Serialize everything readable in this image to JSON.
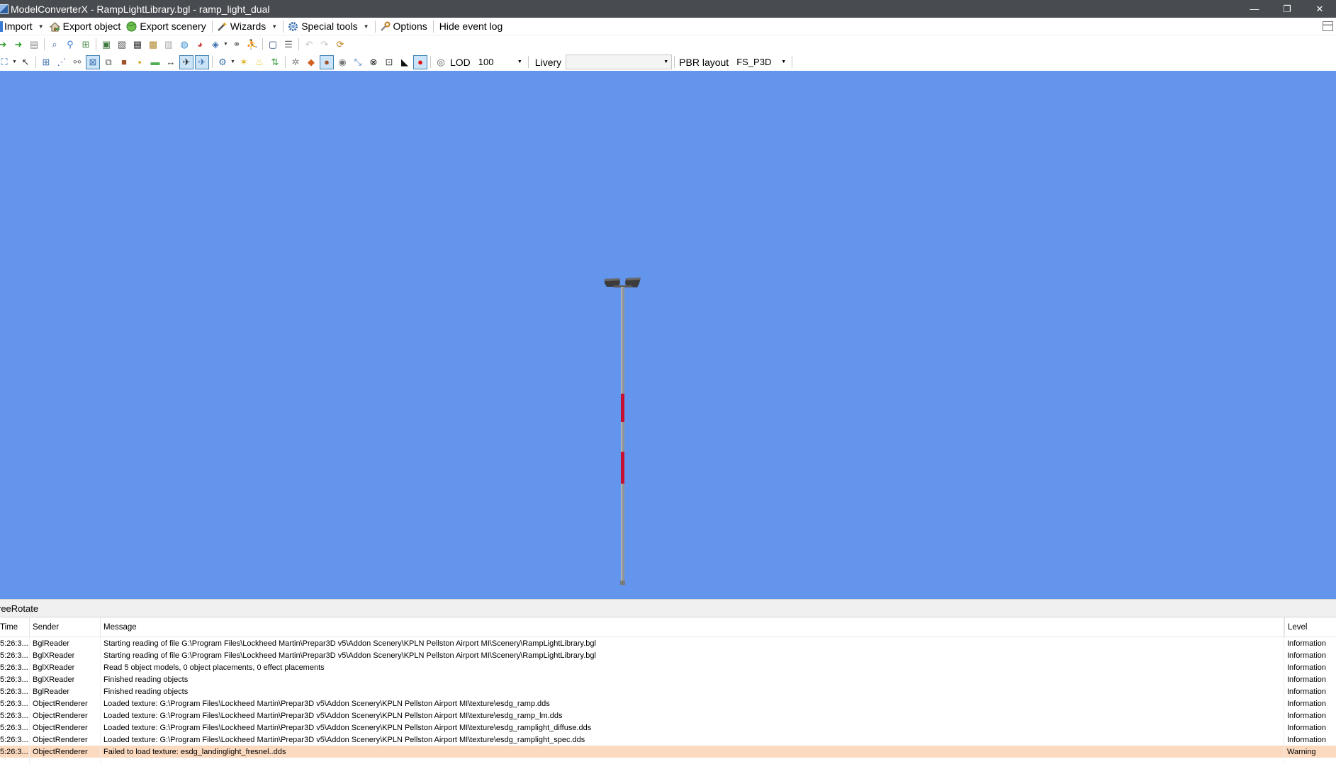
{
  "window": {
    "title": "ModelConverterX - RampLightLibrary.bgl - ramp_light_dual",
    "minimize_glyph": "—",
    "restore_glyph": "❐",
    "close_glyph": "✕"
  },
  "menu": {
    "import_label": "Import",
    "export_object_label": "Export object",
    "export_scenery_label": "Export scenery",
    "wizards_label": "Wizards",
    "special_tools_label": "Special tools",
    "options_label": "Options",
    "hide_event_log_label": "Hide event log"
  },
  "toolbar2": {
    "lod_label": "LOD",
    "lod_value": "100",
    "livery_label": "Livery",
    "livery_value": "",
    "pbr_layout_label": "PBR layout",
    "pbr_layout_value": "FS_P3D"
  },
  "viewport": {
    "background_color": "#6495ed",
    "object": "ramp_light_dual"
  },
  "status": {
    "mode": "reeRotate"
  },
  "event_log": {
    "columns": {
      "time": "Time",
      "sender": "Sender",
      "message": "Message",
      "level": "Level"
    },
    "rows": [
      {
        "time": "5:26:3...",
        "sender": "BglReader",
        "message": "Starting reading of file G:\\Program Files\\Lockheed Martin\\Prepar3D v5\\Addon Scenery\\KPLN Pellston Airport MI\\Scenery\\RampLightLibrary.bgl",
        "level": "Information"
      },
      {
        "time": "5:26:3...",
        "sender": "BglXReader",
        "message": "Starting reading of file G:\\Program Files\\Lockheed Martin\\Prepar3D v5\\Addon Scenery\\KPLN Pellston Airport MI\\Scenery\\RampLightLibrary.bgl",
        "level": "Information"
      },
      {
        "time": "5:26:3...",
        "sender": "BglXReader",
        "message": "Read 5 object models, 0 object placements, 0 effect placements",
        "level": "Information"
      },
      {
        "time": "5:26:3...",
        "sender": "BglXReader",
        "message": "Finished reading objects",
        "level": "Information"
      },
      {
        "time": "5:26:3...",
        "sender": "BglReader",
        "message": "Finished reading objects",
        "level": "Information"
      },
      {
        "time": "5:26:3...",
        "sender": "ObjectRenderer",
        "message": "Loaded texture: G:\\Program Files\\Lockheed Martin\\Prepar3D v5\\Addon Scenery\\KPLN Pellston Airport MI\\texture\\esdg_ramp.dds",
        "level": "Information"
      },
      {
        "time": "5:26:3...",
        "sender": "ObjectRenderer",
        "message": "Loaded texture: G:\\Program Files\\Lockheed Martin\\Prepar3D v5\\Addon Scenery\\KPLN Pellston Airport MI\\texture\\esdg_ramp_lm.dds",
        "level": "Information"
      },
      {
        "time": "5:26:3...",
        "sender": "ObjectRenderer",
        "message": "Loaded texture: G:\\Program Files\\Lockheed Martin\\Prepar3D v5\\Addon Scenery\\KPLN Pellston Airport MI\\texture\\esdg_ramplight_diffuse.dds",
        "level": "Information"
      },
      {
        "time": "5:26:3...",
        "sender": "ObjectRenderer",
        "message": "Loaded texture: G:\\Program Files\\Lockheed Martin\\Prepar3D v5\\Addon Scenery\\KPLN Pellston Airport MI\\texture\\esdg_ramplight_spec.dds",
        "level": "Information"
      },
      {
        "time": "5:26:3...",
        "sender": "ObjectRenderer",
        "message": "Failed to load texture: esdg_landinglight_fresnel..dds",
        "level": "Warning"
      }
    ],
    "warning_color": "#fcdac0"
  }
}
